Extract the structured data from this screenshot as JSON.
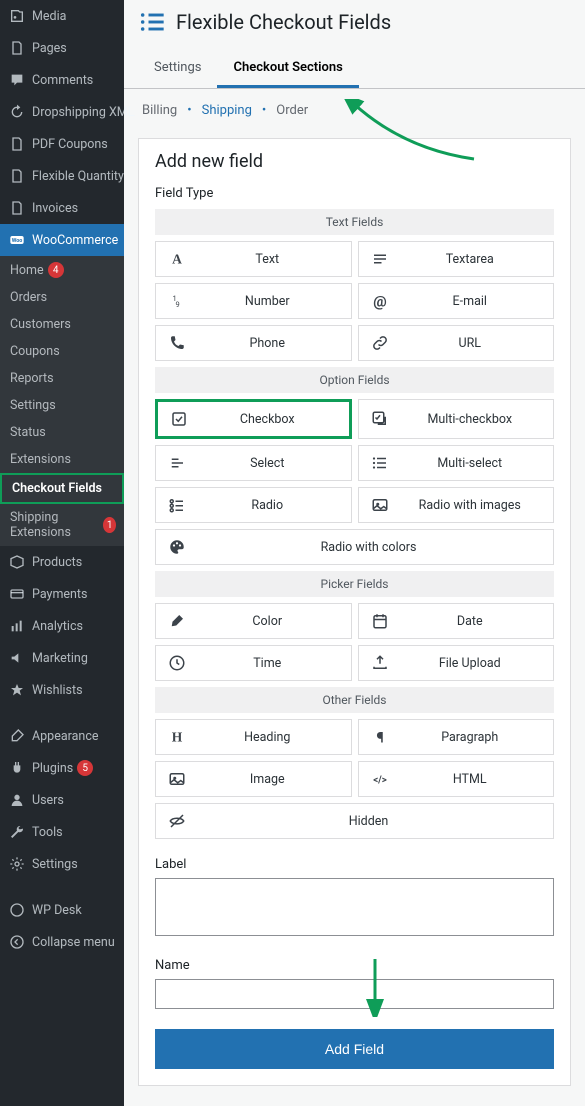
{
  "page": {
    "title": "Flexible Checkout Fields"
  },
  "sidebar": {
    "items": [
      {
        "icon": "media",
        "label": "Media"
      },
      {
        "icon": "page",
        "label": "Pages"
      },
      {
        "icon": "comment",
        "label": "Comments"
      },
      {
        "icon": "refresh",
        "label": "Dropshipping XML"
      },
      {
        "icon": "page",
        "label": "PDF Coupons"
      },
      {
        "icon": "page",
        "label": "Flexible Quantity"
      },
      {
        "icon": "page",
        "label": "Invoices"
      },
      {
        "icon": "woo",
        "label": "WooCommerce",
        "active": true
      }
    ],
    "subs": [
      {
        "label": "Home",
        "badge": "4"
      },
      {
        "label": "Orders"
      },
      {
        "label": "Customers"
      },
      {
        "label": "Coupons"
      },
      {
        "label": "Reports"
      },
      {
        "label": "Settings"
      },
      {
        "label": "Status"
      },
      {
        "label": "Extensions"
      },
      {
        "label": "Checkout Fields",
        "highlight": true
      },
      {
        "label": "Shipping Extensions",
        "badge": "1"
      }
    ],
    "items2": [
      {
        "icon": "box",
        "label": "Products"
      },
      {
        "icon": "card",
        "label": "Payments"
      },
      {
        "icon": "chart",
        "label": "Analytics"
      },
      {
        "icon": "mega",
        "label": "Marketing"
      },
      {
        "icon": "star",
        "label": "Wishlists"
      },
      {
        "spacer": true
      },
      {
        "icon": "brush",
        "label": "Appearance"
      },
      {
        "icon": "plug",
        "label": "Plugins",
        "badge": "5"
      },
      {
        "icon": "user",
        "label": "Users"
      },
      {
        "icon": "wrench",
        "label": "Tools"
      },
      {
        "icon": "gear",
        "label": "Settings"
      },
      {
        "spacer": true
      },
      {
        "icon": "wp",
        "label": "WP Desk"
      },
      {
        "icon": "collapse",
        "label": "Collapse menu"
      }
    ]
  },
  "tabs": [
    {
      "label": "Settings"
    },
    {
      "label": "Checkout Sections",
      "active": true
    }
  ],
  "crumbs": {
    "billing": "Billing",
    "shipping": "Shipping",
    "order": "Order"
  },
  "panel": {
    "heading": "Add new field",
    "fieldTypeLabel": "Field Type",
    "labelLabel": "Label",
    "nameLabel": "Name",
    "addButton": "Add Field",
    "categories": [
      {
        "title": "Text Fields",
        "items": [
          {
            "id": "text",
            "label": "Text",
            "icon": "A"
          },
          {
            "id": "textarea",
            "label": "Textarea",
            "icon": "lines"
          },
          {
            "id": "number",
            "label": "Number",
            "icon": "num"
          },
          {
            "id": "email",
            "label": "E-mail",
            "icon": "at"
          },
          {
            "id": "phone",
            "label": "Phone",
            "icon": "phone"
          },
          {
            "id": "url",
            "label": "URL",
            "icon": "link"
          }
        ]
      },
      {
        "title": "Option Fields",
        "items": [
          {
            "id": "checkbox",
            "label": "Checkbox",
            "icon": "check",
            "selected": true
          },
          {
            "id": "multicheckbox",
            "label": "Multi-checkbox",
            "icon": "mcheck"
          },
          {
            "id": "select",
            "label": "Select",
            "icon": "select"
          },
          {
            "id": "multiselect",
            "label": "Multi-select",
            "icon": "mselect"
          },
          {
            "id": "radio",
            "label": "Radio",
            "icon": "radio"
          },
          {
            "id": "radioimg",
            "label": "Radio with images",
            "icon": "img"
          },
          {
            "id": "radiocolor",
            "label": "Radio with colors",
            "icon": "palette",
            "full": true
          }
        ]
      },
      {
        "title": "Picker Fields",
        "items": [
          {
            "id": "color",
            "label": "Color",
            "icon": "brush"
          },
          {
            "id": "date",
            "label": "Date",
            "icon": "cal"
          },
          {
            "id": "time",
            "label": "Time",
            "icon": "clock"
          },
          {
            "id": "file",
            "label": "File Upload",
            "icon": "upload"
          }
        ]
      },
      {
        "title": "Other Fields",
        "items": [
          {
            "id": "heading",
            "label": "Heading",
            "icon": "H"
          },
          {
            "id": "paragraph",
            "label": "Paragraph",
            "icon": "para"
          },
          {
            "id": "image",
            "label": "Image",
            "icon": "img"
          },
          {
            "id": "html",
            "label": "HTML",
            "icon": "code"
          },
          {
            "id": "hidden",
            "label": "Hidden",
            "icon": "eye",
            "full": true
          }
        ]
      }
    ]
  }
}
